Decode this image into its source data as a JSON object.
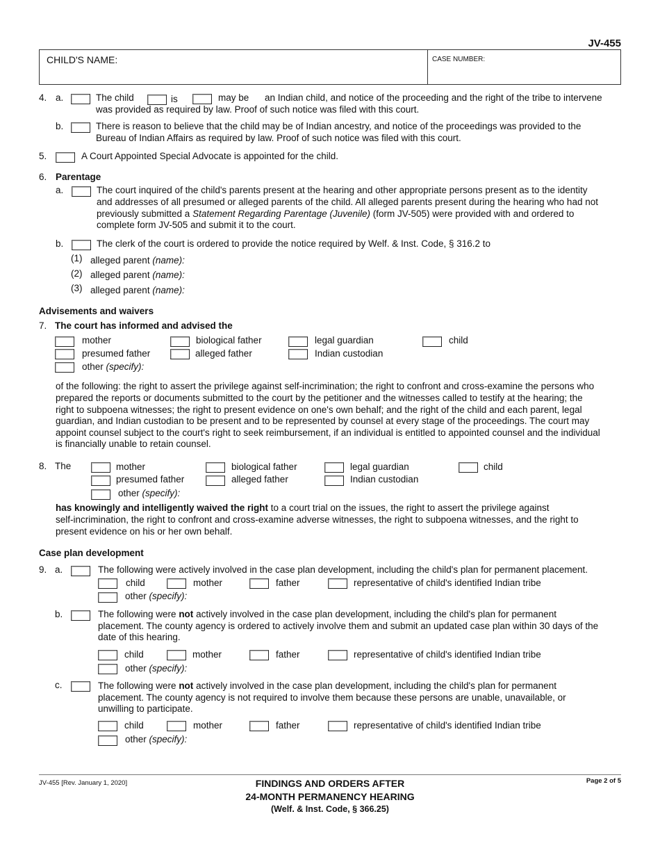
{
  "header": {
    "form_id": "JV-455",
    "childs_name_label": "CHILD'S NAME:",
    "childs_name_value": "",
    "case_number_label": "CASE NUMBER:",
    "case_number_value": ""
  },
  "item4": {
    "num": "4.",
    "a": {
      "letter": "a.",
      "the_child": "The  child",
      "is": "is",
      "may_be": "may be",
      "line1_rest": "an Indian child, and notice of the proceeding and the right of the tribe to intervene",
      "line2": "was provided as required by law. Proof of such notice was filed with this court."
    },
    "b": {
      "letter": "b.",
      "line1": "There is reason to believe that the child may be of Indian ancestry, and notice of the proceedings was provided to the",
      "line2": "Bureau of Indian Affairs as required by law. Proof of such notice was filed with this court."
    }
  },
  "item5": {
    "num": "5.",
    "text": "A Court Appointed Special Advocate is appointed for the child."
  },
  "item6": {
    "num": "6.",
    "title": "Parentage",
    "a": {
      "letter": "a.",
      "line1": "The court inquired of the child's parents present at the hearing and other appropriate persons present as to the identity",
      "line2": "and addresses of all presumed or alleged parents of the child. All alleged parents present during the hearing who had not",
      "line3_pre": "previously submitted a ",
      "line3_italic": "Statement Regarding Parentage (Juvenile)",
      "line3_post": " (form JV-505) were provided with and ordered to",
      "line4": "complete form JV-505 and submit it to the court."
    },
    "b": {
      "letter": "b.",
      "text": "The clerk of the court is ordered to provide the notice required by Welf. & Inst. Code, § 316.2 to",
      "parents": [
        {
          "num": "(1)",
          "label": "alleged parent ",
          "hint": "(name):",
          "value": ""
        },
        {
          "num": "(2)",
          "label": "alleged parent ",
          "hint": "(name):",
          "value": ""
        },
        {
          "num": "(3)",
          "label": "alleged parent ",
          "hint": "(name):",
          "value": ""
        }
      ]
    }
  },
  "advisements": {
    "heading": "Advisements and waivers",
    "item7": {
      "num": "7.",
      "title": "The court has informed and advised the",
      "options": [
        "mother",
        "biological father",
        "legal guardian",
        "child",
        "presumed father",
        "alleged father",
        "Indian custodian"
      ],
      "other_label": "other ",
      "other_hint": "(specify):",
      "paragraph": [
        "of the following: the right to assert the privilege against self-incrimination; the right to confront and cross-examine the persons who",
        "prepared the reports or documents submitted to the court by the petitioner and the witnesses called to testify at the hearing; the",
        "right to subpoena witnesses; the right to present evidence on one's own behalf; and the right of the child and each parent, legal",
        "guardian, and Indian custodian to be present and to be represented by counsel at every stage of the proceedings. The court may",
        "appoint counsel subject to the court's right to seek reimbursement, if an individual is entitled to appointed counsel and the individual",
        "is financially unable to retain counsel."
      ]
    },
    "item8": {
      "num": "8.",
      "lead": "The",
      "options": [
        "mother",
        "biological father",
        "legal guardian",
        "child",
        "presumed father",
        "alleged father",
        "Indian custodian"
      ],
      "other_label": "other ",
      "other_hint": "(specify):",
      "bold_lead": "has knowingly and intelligently waived the right",
      "line1_rest": " to a court trial on the issues, the right to assert the privilege against",
      "line2": "self-incrimination, the right to confront and cross-examine adverse witnesses, the right to subpoena witnesses, and the right to",
      "line3": "present evidence on his or her own behalf."
    }
  },
  "case_plan": {
    "heading": "Case plan development",
    "item9": {
      "num": "9.",
      "a": {
        "letter": "a.",
        "line1": "The following were actively involved in the case plan development, including the child's plan for permanent placement."
      },
      "b": {
        "letter": "b.",
        "line1_pre": "The following were ",
        "line1_bold": "not",
        "line1_post": " actively involved in the case plan development, including the child's plan for permanent",
        "line2": "placement. The county agency is ordered to actively involve them and submit an updated case plan within 30 days of the",
        "line3": "date of this hearing."
      },
      "c": {
        "letter": "c.",
        "line1_pre": "The following were ",
        "line1_bold": "not",
        "line1_post": " actively involved in the case plan development, including the child's plan for permanent",
        "line2": "placement. The county agency is not required to involve them because these persons are unable, unavailable, or",
        "line3": "unwilling to participate."
      },
      "options": [
        "child",
        "mother",
        "father",
        "representative of child's identified Indian tribe"
      ],
      "other_label": "other ",
      "other_hint": "(specify):"
    }
  },
  "footer": {
    "form_rev": "JV-455 [Rev. January 1, 2020]",
    "title1": "FINDINGS AND ORDERS AFTER",
    "title2": "24-MONTH PERMANENCY HEARING",
    "title3": "(Welf. & Inst. Code, § 366.25)",
    "page": "Page 2 of 5"
  }
}
